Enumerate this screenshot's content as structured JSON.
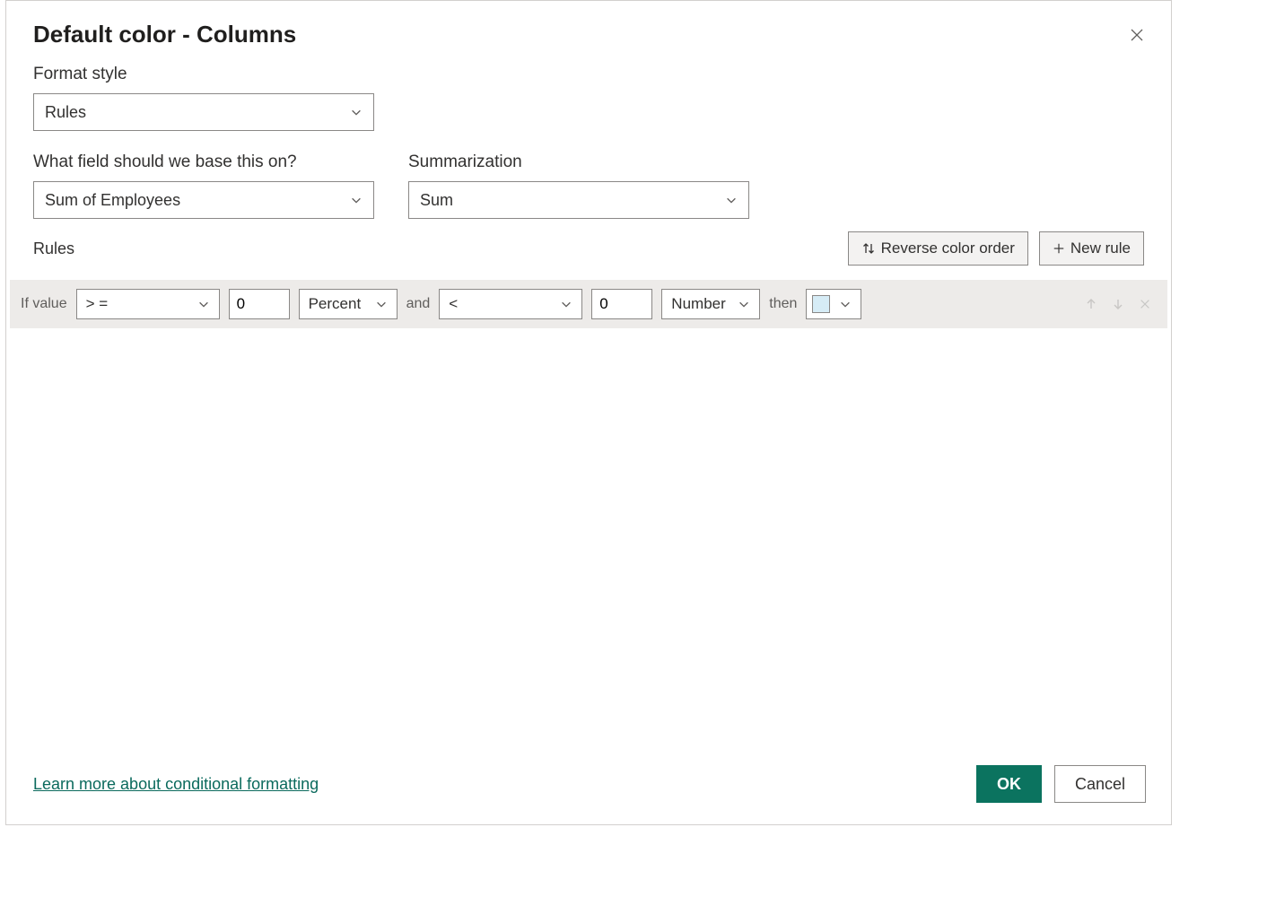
{
  "header": {
    "title": "Default color - Columns"
  },
  "formatStyle": {
    "label": "Format style",
    "value": "Rules"
  },
  "basedOn": {
    "label": "What field should we base this on?",
    "value": "Sum of Employees"
  },
  "summarization": {
    "label": "Summarization",
    "value": "Sum"
  },
  "rules": {
    "label": "Rules",
    "reverseBtn": "Reverse color order",
    "newRuleBtn": "New rule"
  },
  "rule0": {
    "ifValueLabel": "If value",
    "op1": "> =",
    "val1": "0",
    "unit1": "Percent",
    "andLabel": "and",
    "op2": "<",
    "val2": "0",
    "unit2": "Number",
    "thenLabel": "then",
    "color": "#d6ecf6"
  },
  "footer": {
    "learnMore": "Learn more about conditional formatting",
    "ok": "OK",
    "cancel": "Cancel"
  }
}
